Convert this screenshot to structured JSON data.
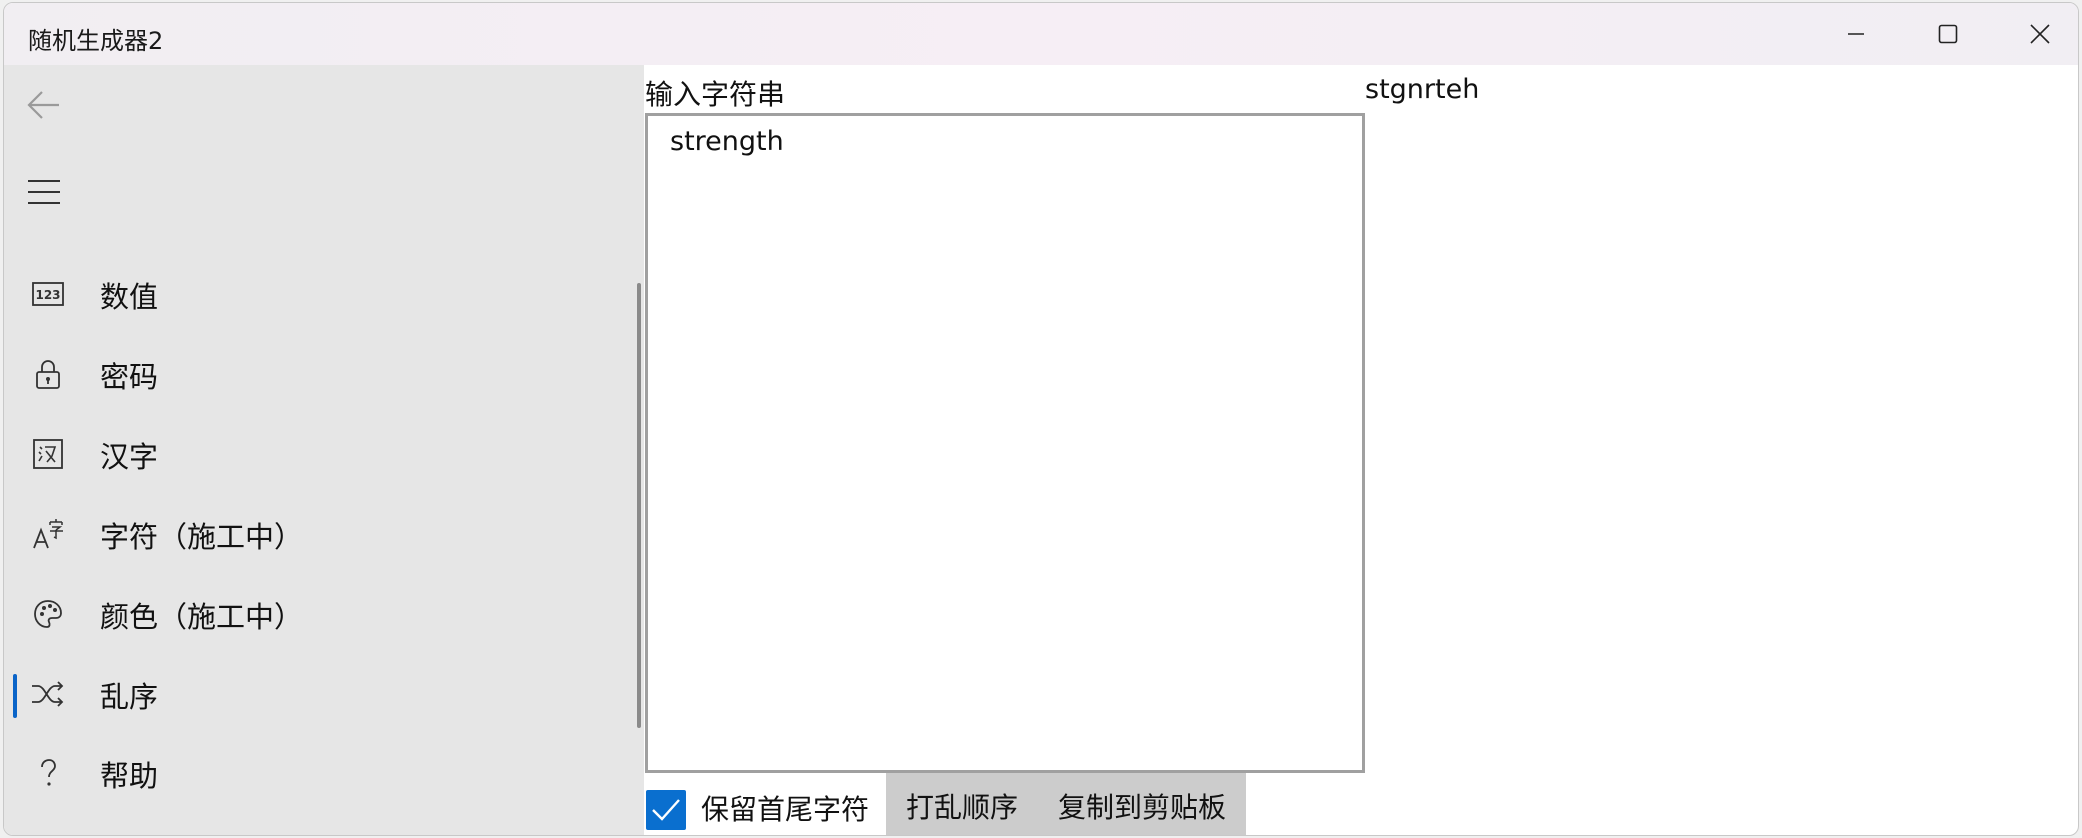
{
  "window": {
    "title": "随机生成器2"
  },
  "nav": {
    "items": [
      {
        "label": "数值",
        "icon": "number-123-icon"
      },
      {
        "label": "密码",
        "icon": "lock-icon"
      },
      {
        "label": "汉字",
        "icon": "hanzi-icon"
      },
      {
        "label": "字符（施工中）",
        "icon": "character-icon"
      },
      {
        "label": "颜色（施工中）",
        "icon": "palette-icon"
      },
      {
        "label": "乱序",
        "icon": "shuffle-icon",
        "selected": true
      },
      {
        "label": "帮助",
        "icon": "help-icon"
      }
    ]
  },
  "main": {
    "input_label": "输入字符串",
    "input_value": "strength",
    "output_value": "stgnrteh",
    "keep_ends_label": "保留首尾字符",
    "keep_ends_checked": true,
    "shuffle_button": "打乱顺序",
    "copy_button": "复制到剪贴板"
  },
  "colors": {
    "accent": "#0a6fcf",
    "nav_bg": "#e6e6e6",
    "button_bg": "#cccccc"
  }
}
